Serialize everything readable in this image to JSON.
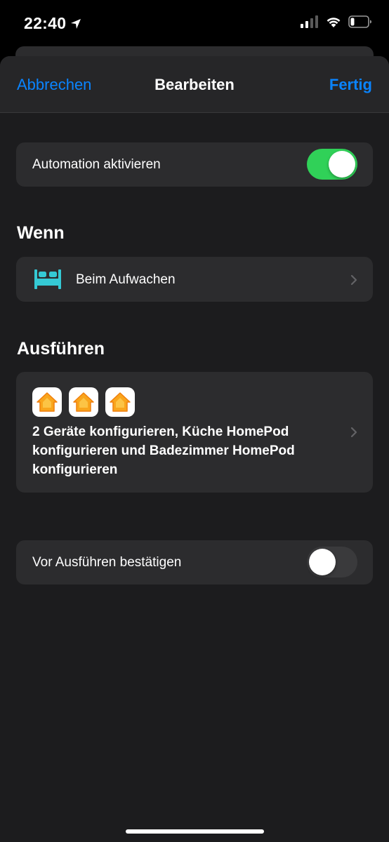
{
  "status_bar": {
    "time": "22:40",
    "location_icon": "location-arrow-icon",
    "signal_icon": "cellular-signal-icon",
    "wifi_icon": "wifi-icon",
    "battery_icon": "battery-low-icon"
  },
  "nav": {
    "cancel_label": "Abbrechen",
    "title": "Bearbeiten",
    "done_label": "Fertig"
  },
  "automation_toggle": {
    "label": "Automation aktivieren",
    "state": "on"
  },
  "when_section": {
    "header": "Wenn",
    "trigger_label": "Beim Aufwachen",
    "trigger_icon": "bed-icon"
  },
  "execute_section": {
    "header": "Ausführen",
    "action_icons": [
      "home-app-icon",
      "home-app-icon",
      "home-app-icon"
    ],
    "action_text": "2 Geräte konfigurieren, Küche HomePod konfigurieren und Badezimmer HomePod konfigurieren"
  },
  "confirm_toggle": {
    "label": "Vor Ausführen bestätigen",
    "state": "off"
  },
  "colors": {
    "accent": "#0a84ff",
    "toggle_on": "#30d158",
    "bed_icon": "#35c9d4",
    "home_icon": "#f9a51c"
  }
}
